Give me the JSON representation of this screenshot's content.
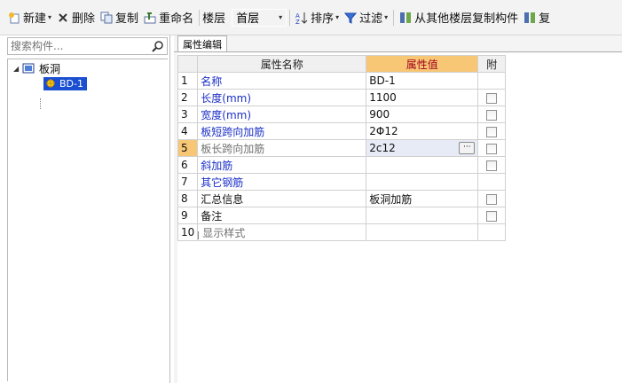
{
  "toolbar": {
    "new_label": "新建",
    "delete_label": "删除",
    "copy_label": "复制",
    "rename_label": "重命名",
    "floor_label": "楼层",
    "floor_value": "首层",
    "sort_label": "排序",
    "filter_label": "过滤",
    "copy_from_floor_label": "从其他楼层复制构件",
    "copy_partial_label": "复"
  },
  "search": {
    "placeholder": "搜索构件..."
  },
  "tree": {
    "root_label": "板洞",
    "child_label": "BD-1"
  },
  "tab_label": "属性编辑",
  "grid": {
    "headers": {
      "name": "属性名称",
      "value": "属性值",
      "attach": "附"
    },
    "rows": [
      {
        "num": "1",
        "name": "名称",
        "value": "BD-1"
      },
      {
        "num": "2",
        "name": "长度(mm)",
        "value": "1100"
      },
      {
        "num": "3",
        "name": "宽度(mm)",
        "value": "900"
      },
      {
        "num": "4",
        "name": "板短跨向加筋",
        "value": "2Φ12"
      },
      {
        "num": "5",
        "name": "板长跨向加筋",
        "value": "2c12"
      },
      {
        "num": "6",
        "name": "斜加筋",
        "value": ""
      },
      {
        "num": "7",
        "name": "其它钢筋",
        "value": ""
      },
      {
        "num": "8",
        "name": "汇总信息",
        "value": "板洞加筋"
      },
      {
        "num": "9",
        "name": "备注",
        "value": ""
      },
      {
        "num": "10",
        "name": "显示样式",
        "value": ""
      }
    ],
    "ellipsis": "···"
  }
}
